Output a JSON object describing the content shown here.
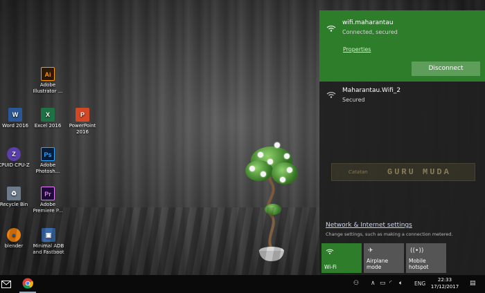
{
  "desktop": {
    "icons": [
      {
        "label": "Adobe Illustrator ...",
        "glyph": "Ai",
        "color": "#2b1a05",
        "fg": "#ff9a00"
      },
      {
        "label": "Word 2016",
        "glyph": "W",
        "color": "#2b5797",
        "fg": "#ffffff"
      },
      {
        "label": "Excel 2016",
        "glyph": "X",
        "color": "#1e7145",
        "fg": "#ffffff"
      },
      {
        "label": "PowerPoint 2016",
        "glyph": "P",
        "color": "#d24726",
        "fg": "#ffffff"
      },
      {
        "label": "CPUID CPU-Z",
        "glyph": "Z",
        "color": "#5b3fa8",
        "fg": "#ffffff"
      },
      {
        "label": "Adobe Photosh...",
        "glyph": "Ps",
        "color": "#061e3a",
        "fg": "#31a8ff"
      },
      {
        "label": "Recycle Bin",
        "glyph": "♻",
        "color": "#6b7b8c",
        "fg": "#ffffff"
      },
      {
        "label": "Adobe Premiere P...",
        "glyph": "Pr",
        "color": "#1f0a3a",
        "fg": "#e77cff"
      },
      {
        "label": "blender",
        "glyph": "●",
        "color": "#e87d0d",
        "fg": "#1b5fa8"
      },
      {
        "label": "Minimal ADB and Fastboot",
        "glyph": "▣",
        "color": "#3465a4",
        "fg": "#ffffff"
      }
    ]
  },
  "network": {
    "active": {
      "name": "wifi.maharantau",
      "status": "Connected, secured",
      "properties": "Properties",
      "disconnect": "Disconnect"
    },
    "other": {
      "name": "Maharantau.Wifi_2",
      "status": "Secured"
    },
    "watermark": {
      "prefix": "Catatan",
      "title": "GURU MUDA"
    },
    "settings_link": "Network & Internet settings",
    "settings_desc": "Change settings, such as making a connection metered.",
    "tiles": [
      {
        "label": "Wi-Fi",
        "icon": "wifi-icon",
        "active": true
      },
      {
        "label": "Airplane mode",
        "icon": "airplane-icon",
        "active": false
      },
      {
        "label": "Mobile hotspot",
        "icon": "hotspot-icon",
        "active": false
      }
    ],
    "accent": "#2d7d2a"
  },
  "taskbar": {
    "lang": "ENG",
    "time": "22:33",
    "date": "17/12/2017"
  }
}
